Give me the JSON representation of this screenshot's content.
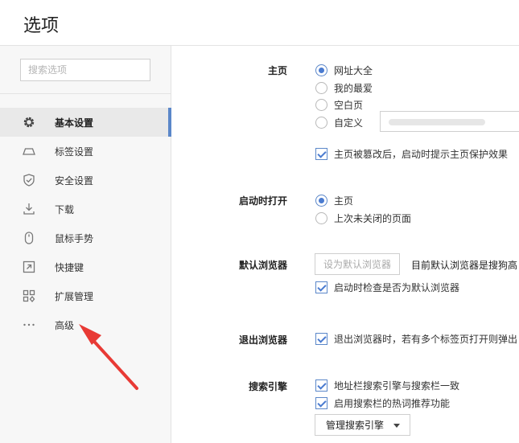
{
  "window": {
    "title": "选项"
  },
  "sidebar": {
    "search_placeholder": "搜索选项",
    "items": [
      {
        "label": "基本设置",
        "icon": "gear-icon",
        "active": true
      },
      {
        "label": "标签设置",
        "icon": "tab-icon"
      },
      {
        "label": "安全设置",
        "icon": "shield-icon"
      },
      {
        "label": "下载",
        "icon": "download-icon"
      },
      {
        "label": "鼠标手势",
        "icon": "mouse-icon"
      },
      {
        "label": "快捷键",
        "icon": "shortcut-icon"
      },
      {
        "label": "扩展管理",
        "icon": "extensions-icon"
      },
      {
        "label": "高级",
        "icon": "more-icon"
      }
    ]
  },
  "homepage": {
    "label": "主页",
    "options": [
      "网址大全",
      "我的最爱",
      "空白页",
      "自定义"
    ],
    "selected": "网址大全",
    "protect_checkbox": "主页被篡改后，启动时提示主页保护效果"
  },
  "startup": {
    "label": "启动时打开",
    "options": [
      "主页",
      "上次未关闭的页面"
    ],
    "selected": "主页"
  },
  "default_browser": {
    "label": "默认浏览器",
    "button": "设为默认浏览器",
    "status": "目前默认浏览器是搜狗高",
    "check_on_start": "启动时检查是否为默认浏览器"
  },
  "exit_browser": {
    "label": "退出浏览器",
    "checkbox": "退出浏览器时，若有多个标签页打开则弹出"
  },
  "search_engine": {
    "label": "搜索引擎",
    "sync_checkbox": "地址栏搜索引擎与搜索栏一致",
    "hot_checkbox": "启用搜索栏的热词推荐功能",
    "manage_button": "管理搜索引擎"
  },
  "colors": {
    "accent": "#4a7bd0",
    "active_bar": "#5b87c9",
    "arrow": "#e83a35"
  }
}
